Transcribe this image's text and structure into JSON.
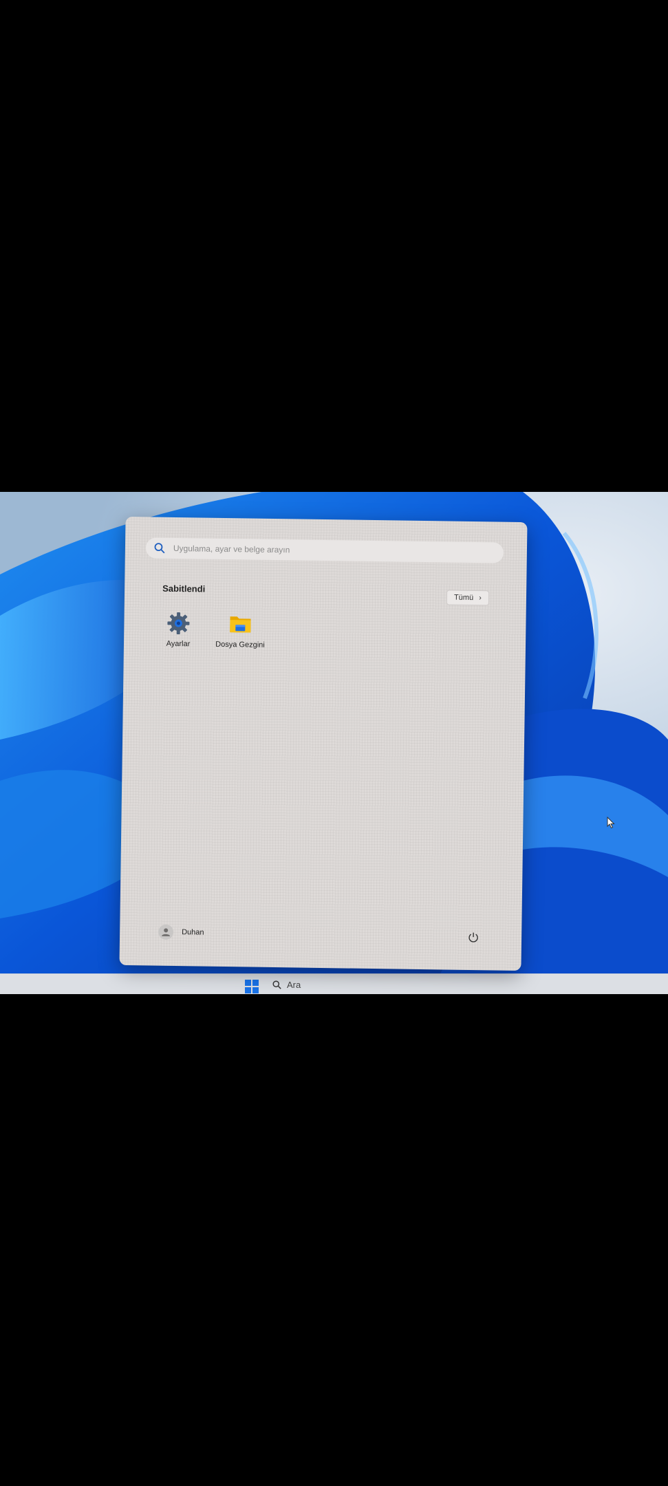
{
  "search": {
    "placeholder": "Uygulama, ayar ve belge arayın"
  },
  "pinned": {
    "title": "Sabitlendi",
    "all_button": "Tümü",
    "apps": [
      {
        "label": "Ayarlar",
        "icon": "settings-gear-icon"
      },
      {
        "label": "Dosya Gezgini",
        "icon": "file-explorer-folder-icon"
      }
    ]
  },
  "footer": {
    "user_name": "Duhan",
    "power_icon": "power-icon"
  },
  "taskbar": {
    "search_label": "Ara"
  },
  "colors": {
    "accent": "#1a73e8",
    "panel": "#dedad8",
    "folder": "#f2b900"
  }
}
